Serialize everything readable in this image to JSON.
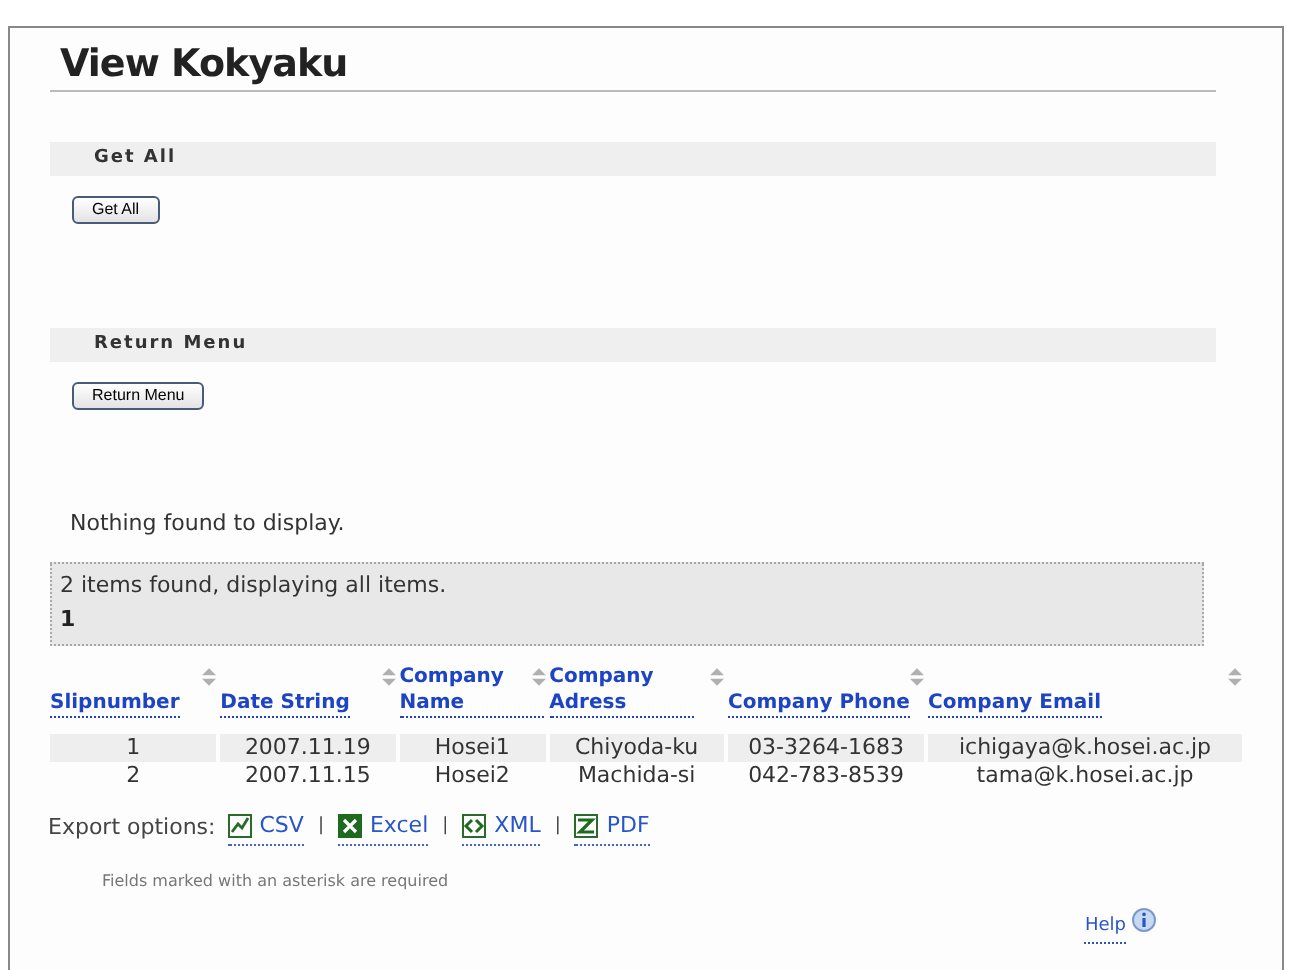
{
  "title": "View Kokyaku",
  "sections": [
    {
      "heading": "Get All",
      "button": "Get All"
    },
    {
      "heading": "Return Menu",
      "button": "Return Menu"
    }
  ],
  "message": "Nothing found to display.",
  "banner": {
    "text": "2 items found, displaying all items.",
    "page": "1"
  },
  "table": {
    "columns": [
      "Slipnumber",
      "Date String",
      "Company Name",
      "Company Adress",
      "Company Phone",
      "Company Email"
    ],
    "rows": [
      [
        "1",
        "2007.11.19",
        "Hosei1",
        "Chiyoda-ku",
        "03-3264-1683",
        "ichigaya@k.hosei.ac.jp"
      ],
      [
        "2",
        "2007.11.15",
        "Hosei2",
        "Machida-si",
        "042-783-8539",
        "tama@k.hosei.ac.jp"
      ]
    ]
  },
  "export": {
    "label": "Export options:",
    "options": [
      {
        "kind": "csv",
        "label": "CSV"
      },
      {
        "kind": "excel",
        "label": "Excel"
      },
      {
        "kind": "xml",
        "label": "XML"
      },
      {
        "kind": "pdf",
        "label": "PDF"
      }
    ],
    "separator": "|"
  },
  "note": "Fields marked with an asterisk are required",
  "help": "Help"
}
